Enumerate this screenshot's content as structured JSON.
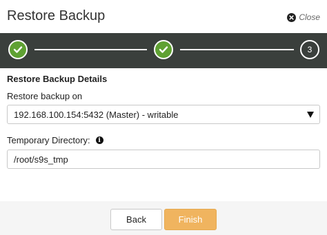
{
  "dialog": {
    "title": "Restore Backup",
    "close_label": "Close"
  },
  "stepper": {
    "steps": [
      {
        "state": "complete",
        "icon": "check-icon"
      },
      {
        "state": "complete",
        "icon": "check-icon"
      },
      {
        "state": "current",
        "number": "3"
      }
    ],
    "colors": {
      "bar": "#3a3f3c",
      "complete": "#5fa133"
    }
  },
  "form": {
    "section_heading": "Restore Backup Details",
    "restore_on": {
      "label": "Restore backup on",
      "selected": "192.168.100.154:5432 (Master) - writable"
    },
    "temp_dir": {
      "label": "Temporary Directory:",
      "value": "/root/s9s_tmp",
      "info_icon": "info-icon"
    }
  },
  "footer": {
    "back_label": "Back",
    "finish_label": "Finish",
    "finish_color": "#f0b45f"
  }
}
